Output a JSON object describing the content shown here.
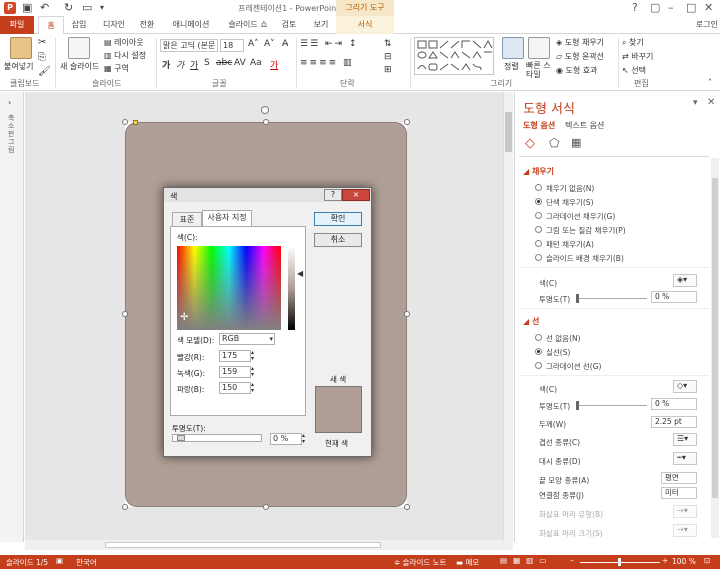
{
  "app": {
    "title": "프레젠테이션1 - PowerPoint",
    "context_tab_group": "그리기 도구",
    "user": "로그인"
  },
  "tabs": [
    "파일",
    "홈",
    "삽입",
    "디자인",
    "전환",
    "애니메이션",
    "슬라이드 쇼",
    "검토",
    "보기",
    "서식"
  ],
  "ribbon": {
    "groups": {
      "clipboard": "클립보드",
      "slides": "슬라이드",
      "font": "글꼴",
      "paragraph": "단락",
      "drawing": "그리기",
      "editing": "편집"
    },
    "paste": "붙여넣기",
    "new_slide": "새 슬라이드",
    "layout": "레이아웃",
    "reset": "다시 설정",
    "section": "구역",
    "font_name": "맑은 고딕 (본문",
    "font_size": "18",
    "arrange": "정렬",
    "quick_styles": "빠른 스타일",
    "shape_fill": "도형 채우기",
    "shape_outline": "도형 윤곽선",
    "shape_effects": "도형 효과",
    "find": "찾기",
    "replace": "바꾸기",
    "select": "선택"
  },
  "pane": {
    "title": "도형 서식",
    "tab_shape": "도형 옵션",
    "tab_text": "텍스트 옵션",
    "fill": {
      "header": "채우기",
      "options": [
        "채우기 없음(N)",
        "단색 채우기(S)",
        "그라데이션 채우기(G)",
        "그림 또는 질감 채우기(P)",
        "패턴 채우기(A)",
        "슬라이드 배경 채우기(B)"
      ],
      "selected": 1,
      "color_label": "색(C)",
      "transparency_label": "투명도(T)",
      "transparency": "0 %"
    },
    "line": {
      "header": "선",
      "options": [
        "선 없음(N)",
        "실선(S)",
        "그라데이션 선(G)"
      ],
      "selected": 1,
      "color_label": "색(C)",
      "transparency_label": "투명도(T)",
      "transparency": "0 %",
      "width_label": "두께(W)",
      "width": "2.25 pt",
      "compound_label": "겹선 종류(C)",
      "dash_label": "대시 종류(D)",
      "cap_label": "끝 모양 종류(A)",
      "cap": "평면",
      "join_label": "연결점 종류(J)",
      "join": "미터",
      "begin_arrow_type": "화살표 머리 유형(B)",
      "begin_arrow_size": "화살표 머리 크기(S)"
    }
  },
  "dialog": {
    "title": "색",
    "help": "?",
    "close": "×",
    "tab_standard": "표준",
    "tab_custom": "사용자 지정",
    "ok": "확인",
    "cancel": "취소",
    "colors_label": "색(C):",
    "color_model_label": "색 모델(D):",
    "color_model": "RGB",
    "red_label": "빨강(R):",
    "red": "175",
    "green_label": "녹색(G):",
    "green": "159",
    "blue_label": "파랑(B):",
    "blue": "150",
    "transparency_label": "투명도(T):",
    "transparency": "0 %",
    "new_label": "새 색",
    "current_label": "현재 색",
    "color_hex": "#af9f96"
  },
  "status": {
    "slide": "슬라이드 1/5",
    "lang": "한국어",
    "notes": "슬라이드 노트",
    "comments": "메모",
    "zoom": "100 %"
  },
  "colors": {
    "accent": "#c43e1c",
    "shape_fill": "#af9f96"
  }
}
